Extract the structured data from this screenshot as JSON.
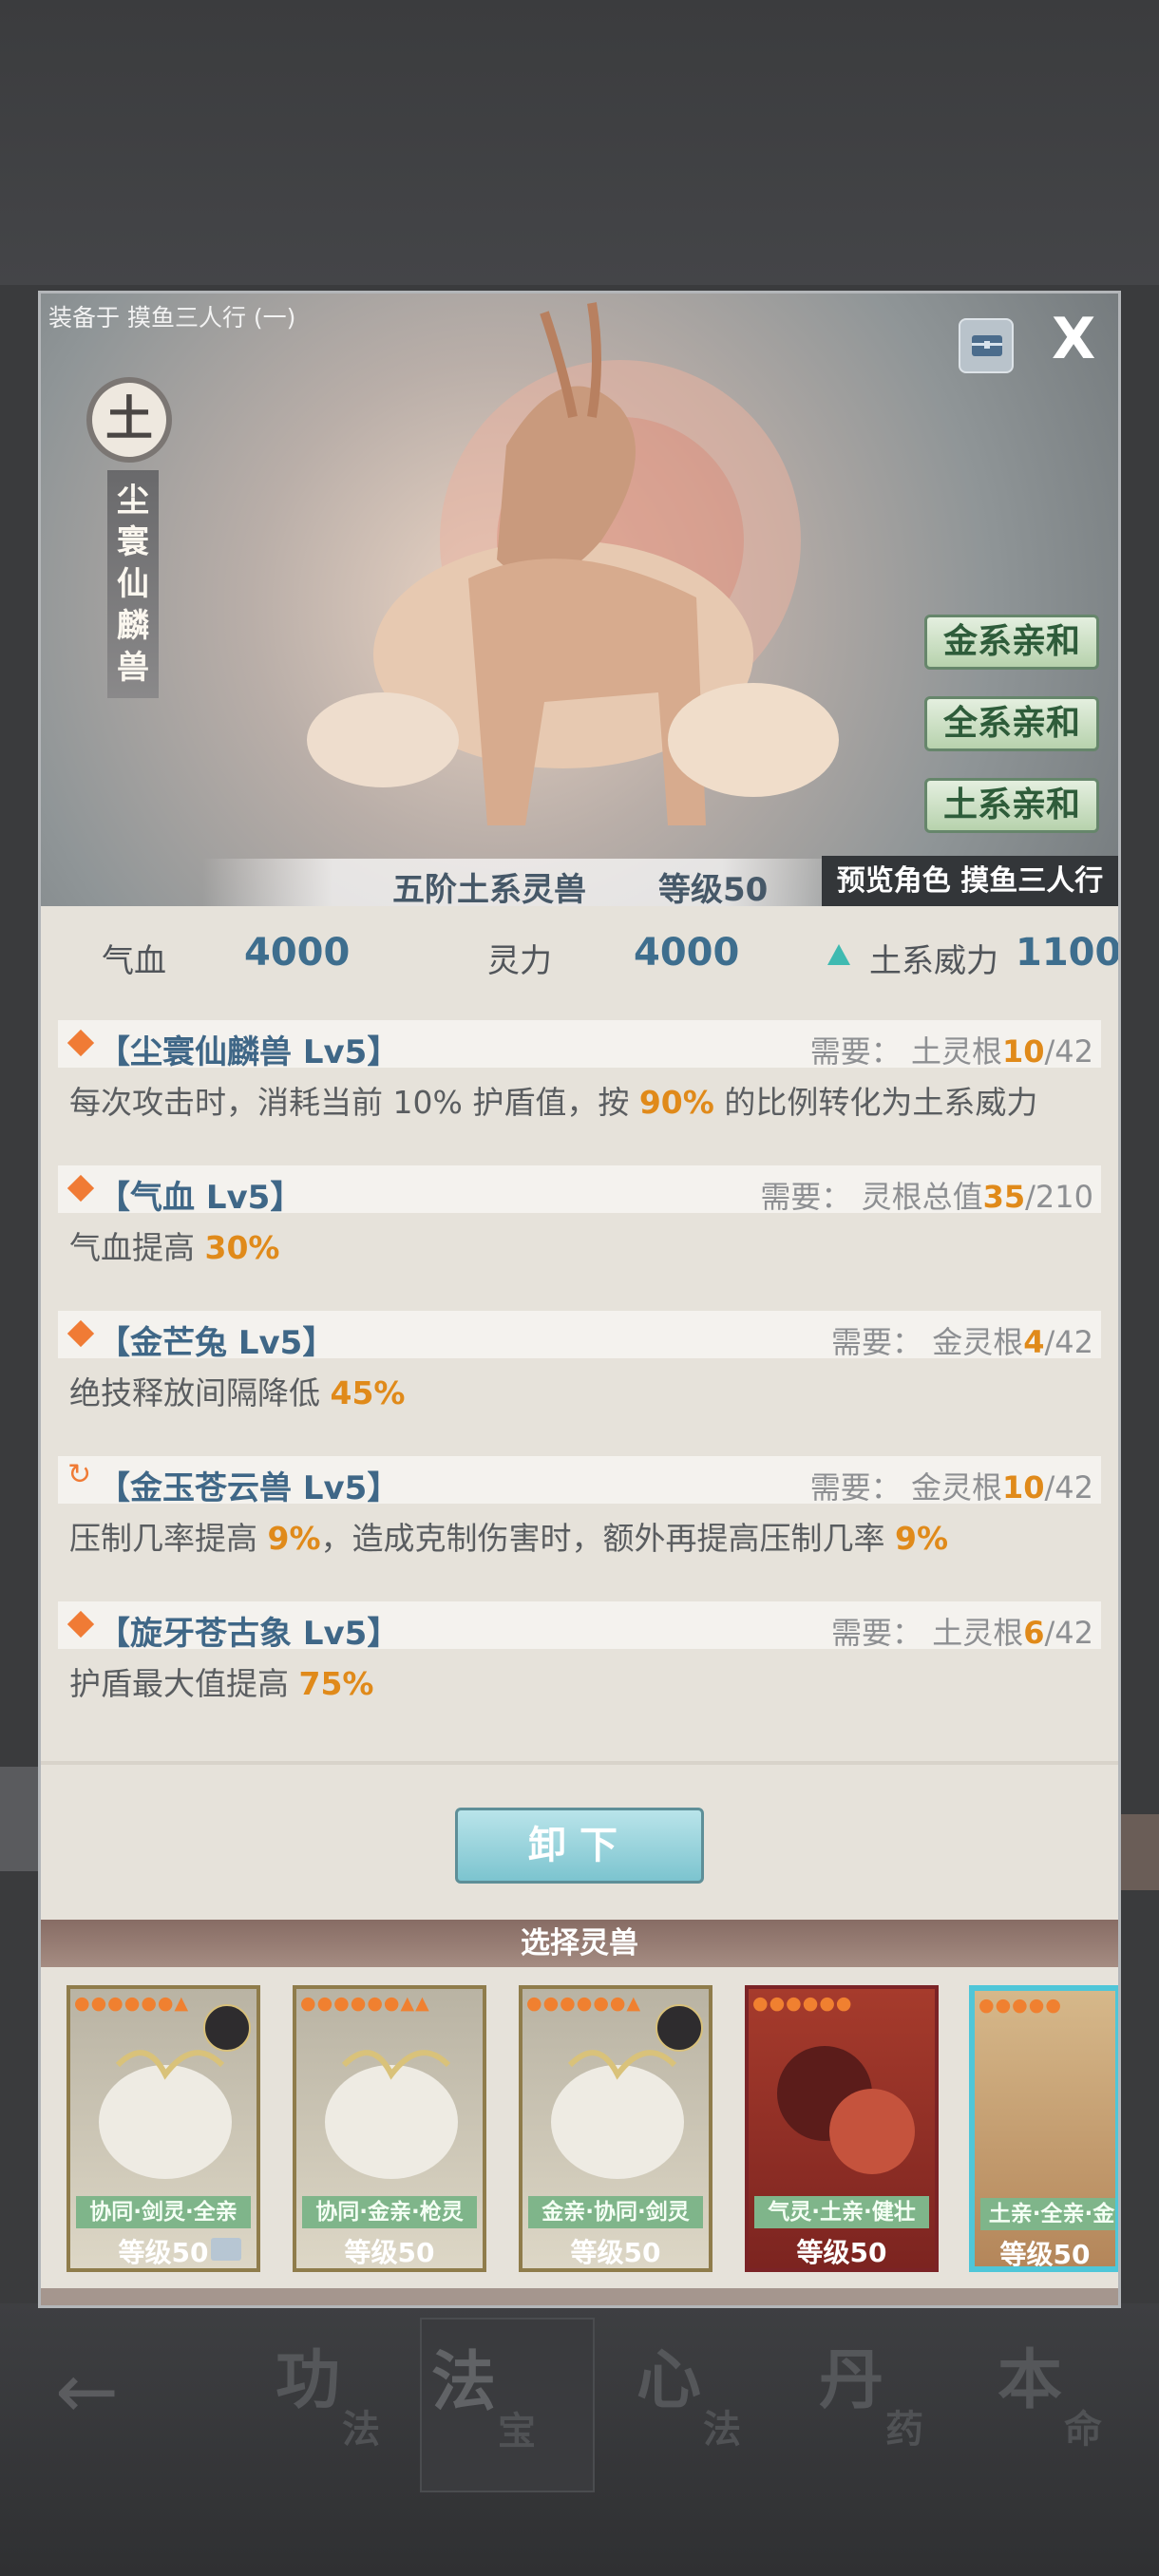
{
  "dialog": {
    "equip_label": "装备于 摸鱼三人行 (一)",
    "close": "X"
  },
  "beast": {
    "element": "土",
    "name_chars": [
      "尘",
      "寰",
      "仙",
      "麟",
      "兽"
    ],
    "affinities": [
      "金系亲和",
      "全系亲和",
      "土系亲和"
    ],
    "tier": "五阶土系灵兽",
    "level": "等级50",
    "preview": "预览角色 摸鱼三人行"
  },
  "stats": {
    "hp_label": "气血",
    "hp_value": "4000",
    "spirit_label": "灵力",
    "spirit_value": "4000",
    "power_label": "土系威力",
    "power_value": "1100"
  },
  "skills": [
    {
      "title": "【尘寰仙麟兽 Lv5】",
      "req_prefix": "需要：",
      "req_name": " 土灵根",
      "req_have": "10",
      "req_total": "/42",
      "desc_a": "每次攻击时，消耗当前 10% 护盾值，按 ",
      "desc_hl1": "90%",
      "desc_b": " 的比例转化为土系威力",
      "desc_hl2": "",
      "desc_c": ""
    },
    {
      "title": "【气血 Lv5】",
      "req_prefix": "需要：",
      "req_name": " 灵根总值",
      "req_have": "35",
      "req_total": "/210",
      "desc_a": "气血提高 ",
      "desc_hl1": "30%",
      "desc_b": "",
      "desc_hl2": "",
      "desc_c": ""
    },
    {
      "title": "【金芒兔 Lv5】",
      "req_prefix": "需要：",
      "req_name": " 金灵根",
      "req_have": "4",
      "req_total": "/42",
      "desc_a": "绝技释放间隔降低 ",
      "desc_hl1": "45%",
      "desc_b": "",
      "desc_hl2": "",
      "desc_c": ""
    },
    {
      "title": "【金玉苍云兽 Lv5】",
      "req_prefix": "需要：",
      "req_name": " 金灵根",
      "req_have": "10",
      "req_total": "/42",
      "desc_a": "压制几率提高 ",
      "desc_hl1": "9%",
      "desc_b": "，造成克制伤害时，额外再提高压制几率 ",
      "desc_hl2": "9%",
      "desc_c": ""
    },
    {
      "title": "【旋牙苍古象 Lv5】",
      "req_prefix": "需要：",
      "req_name": " 土灵根",
      "req_have": "6",
      "req_total": "/42",
      "desc_a": "护盾最大值提高 ",
      "desc_hl1": "75%",
      "desc_b": "",
      "desc_hl2": "",
      "desc_c": ""
    }
  ],
  "unequip_label": "卸下",
  "select_title": "选择灵兽",
  "cards": [
    {
      "tags": "协同·剑灵·全亲",
      "level": "等级50"
    },
    {
      "tags": "协同·金亲·枪灵",
      "level": "等级50"
    },
    {
      "tags": "金亲·协同·剑灵",
      "level": "等级50"
    },
    {
      "tags": "气灵·土亲·健壮",
      "level": "等级50"
    },
    {
      "tags": "土亲·全亲·金",
      "level": "等级50"
    }
  ],
  "nav": {
    "back_icon": "left-arrow",
    "tabs": [
      {
        "big": "功",
        "small": "法"
      },
      {
        "big": "法",
        "small": "宝"
      },
      {
        "big": "心",
        "small": "法"
      },
      {
        "big": "丹",
        "small": "药"
      },
      {
        "big": "本",
        "small": "命"
      }
    ]
  },
  "colors": {
    "accent_orange": "#e08a1a",
    "value_blue": "#3e6e8e",
    "affinity_green": "#2e5c3a",
    "selected_border": "#4fc6d8"
  }
}
